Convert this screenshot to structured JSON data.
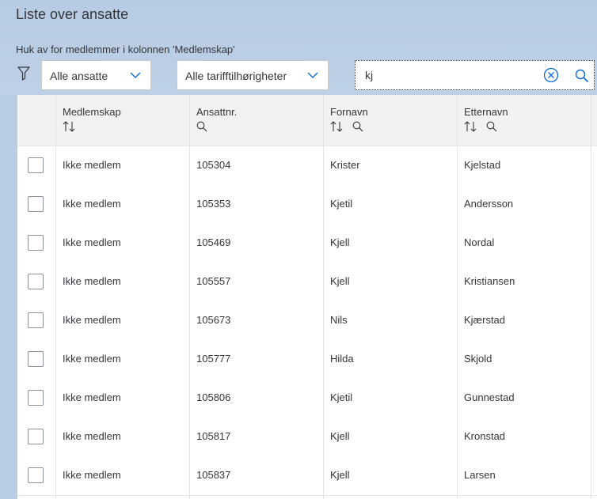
{
  "page": {
    "title": "Liste over ansatte",
    "instruction": "Huk av for medlemmer i kolonnen 'Medlemskap'"
  },
  "filters": {
    "employees_select": "Alle ansatte",
    "tariff_select": "Alle tarifftilhørigheter",
    "search_value": "kj"
  },
  "table": {
    "columns": [
      "Medlemskap",
      "Ansattnr.",
      "Fornavn",
      "Etternavn"
    ],
    "rows": [
      {
        "membership": "Ikke medlem",
        "number": "105304",
        "first": "Krister",
        "last": "Kjelstad"
      },
      {
        "membership": "Ikke medlem",
        "number": "105353",
        "first": "Kjetil",
        "last": "Andersson"
      },
      {
        "membership": "Ikke medlem",
        "number": "105469",
        "first": "Kjell",
        "last": "Nordal"
      },
      {
        "membership": "Ikke medlem",
        "number": "105557",
        "first": "Kjell",
        "last": "Kristiansen"
      },
      {
        "membership": "Ikke medlem",
        "number": "105673",
        "first": "Nils",
        "last": "Kjærstad"
      },
      {
        "membership": "Ikke medlem",
        "number": "105777",
        "first": "Hilda",
        "last": "Skjold"
      },
      {
        "membership": "Ikke medlem",
        "number": "105806",
        "first": "Kjetil",
        "last": "Gunnestad"
      },
      {
        "membership": "Ikke medlem",
        "number": "105817",
        "first": "Kjell",
        "last": "Kronstad"
      },
      {
        "membership": "Ikke medlem",
        "number": "105837",
        "first": "Kjell",
        "last": "Larsen"
      }
    ]
  },
  "colors": {
    "header_band": "#b9cde4",
    "icon_blue": "#0a6ed1",
    "text": "#32363a"
  }
}
